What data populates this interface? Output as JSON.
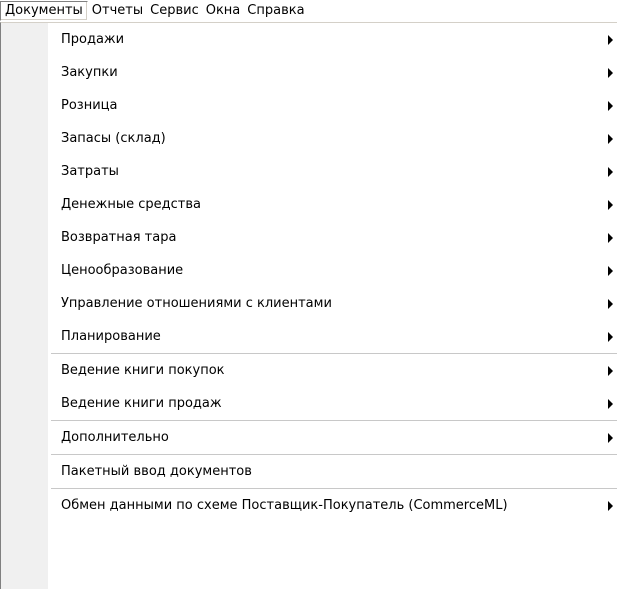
{
  "menubar": {
    "items": [
      {
        "label": "Документы",
        "open": true
      },
      {
        "label": "Отчеты"
      },
      {
        "label": "Сервис"
      },
      {
        "label": "Окна"
      },
      {
        "label": "Справка"
      }
    ]
  },
  "dropdown": {
    "items": [
      {
        "label": "Продажи",
        "submenu": true
      },
      {
        "label": "Закупки",
        "submenu": true
      },
      {
        "label": "Розница",
        "submenu": true
      },
      {
        "label": "Запасы (склад)",
        "submenu": true
      },
      {
        "label": "Затраты",
        "submenu": true
      },
      {
        "label": "Денежные средства",
        "submenu": true
      },
      {
        "label": "Возвратная тара",
        "submenu": true
      },
      {
        "label": "Ценообразование",
        "submenu": true
      },
      {
        "label": "Управление отношениями с клиентами",
        "submenu": true
      },
      {
        "label": "Планирование",
        "submenu": true
      },
      {
        "label": "Ведение книги покупок",
        "submenu": true
      },
      {
        "label": "Ведение книги продаж",
        "submenu": true
      },
      {
        "label": "Дополнительно",
        "submenu": true
      },
      {
        "label": "Пакетный ввод документов",
        "submenu": false
      },
      {
        "label": "Обмен данными по схеме Поставщик-Покупатель (CommerceML)",
        "submenu": true
      }
    ]
  }
}
